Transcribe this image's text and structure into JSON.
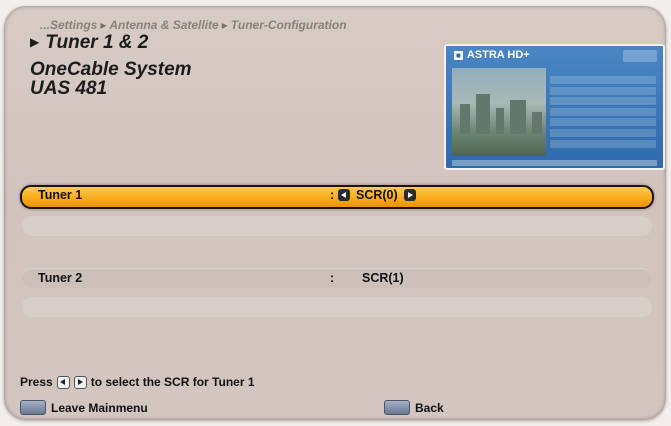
{
  "breadcrumb": {
    "items": [
      "...Settings",
      "Antenna & Satellite",
      "Tuner-Configuration"
    ],
    "separator": "▸"
  },
  "header": {
    "title_line1": "Tuner 1 & 2",
    "title_line2": "OneCable System",
    "title_line3": "UAS 481"
  },
  "preview": {
    "channel_logo": "ASTRA HD+"
  },
  "settings": {
    "tuner1": {
      "label": "Tuner 1",
      "separator": ":",
      "value": "SCR(0)"
    },
    "tuner2": {
      "label": "Tuner 2",
      "separator": ":",
      "value": "SCR(1)"
    }
  },
  "hint": {
    "prefix": "Press",
    "suffix": "to select the SCR for Tuner 1"
  },
  "footer": {
    "menu_label": "Leave Mainmenu",
    "back_label": "Back"
  },
  "colors": {
    "selection": "#f9ac1b",
    "panel": "#d3c5c0",
    "preview_blue": "#2e6aac"
  }
}
